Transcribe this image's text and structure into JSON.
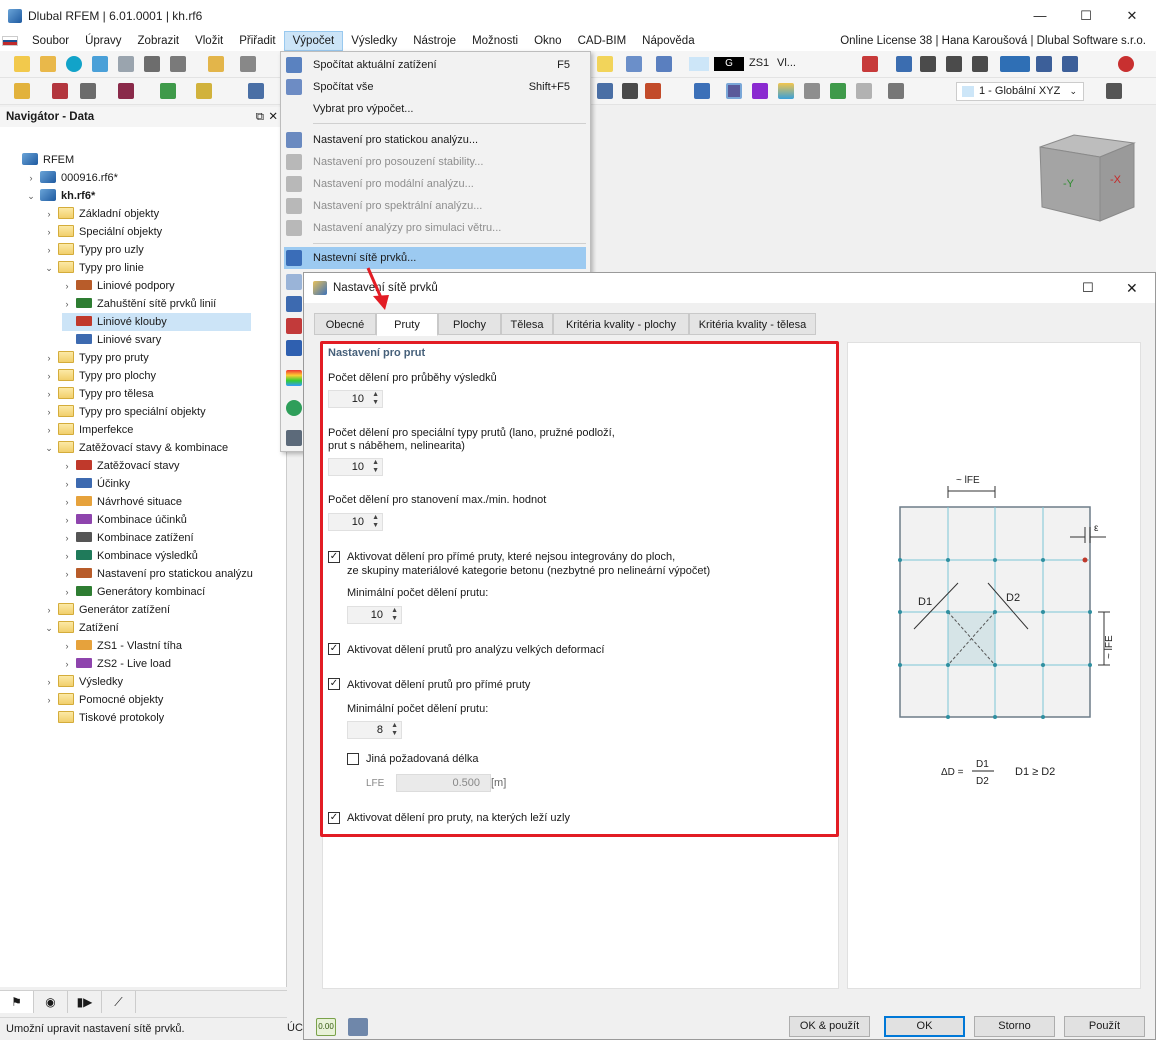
{
  "window": {
    "title": "Dlubal RFEM | 6.01.0001 | kh.rf6",
    "controls": [
      "—",
      "☐",
      "✕"
    ]
  },
  "menubar": {
    "items": [
      "Soubor",
      "Úpravy",
      "Zobrazit",
      "Vložit",
      "Přiřadit",
      "Výpočet",
      "Výsledky",
      "Nástroje",
      "Možnosti",
      "Okno",
      "CAD-BIM",
      "Nápověda"
    ],
    "license": "Online License 38 | Hana Karoušová | Dlubal Software s.r.o."
  },
  "toolbar": {
    "load_case_badge": "G",
    "load_case": "ZS1",
    "load_case_name": "Vl...",
    "view_dropdown": "1 - Globální XYZ"
  },
  "navigator": {
    "title": "Navigátor - Data",
    "pin_icon": "⧉",
    "close_icon": "✕",
    "rows": [
      {
        "label": "RFEM",
        "level": 0,
        "tw": ""
      },
      {
        "label": "000916.rf6*",
        "level": 1,
        "tw": "›"
      },
      {
        "label": "kh.rf6*",
        "level": 1,
        "tw": "⌄"
      },
      {
        "label": "Základní objekty",
        "level": 2,
        "tw": "›"
      },
      {
        "label": "Speciální objekty",
        "level": 2,
        "tw": "›"
      },
      {
        "label": "Typy pro uzly",
        "level": 2,
        "tw": "›"
      },
      {
        "label": "Typy pro linie",
        "level": 2,
        "tw": "⌄"
      },
      {
        "label": "Liniové podpory",
        "level": 3,
        "tw": "›"
      },
      {
        "label": "Zahuštění sítě prvků linií",
        "level": 3,
        "tw": "›"
      },
      {
        "label": "Liniové klouby",
        "level": 3,
        "tw": ""
      },
      {
        "label": "Liniové svary",
        "level": 3,
        "tw": ""
      },
      {
        "label": "Typy pro pruty",
        "level": 2,
        "tw": "›"
      },
      {
        "label": "Typy pro plochy",
        "level": 2,
        "tw": "›"
      },
      {
        "label": "Typy pro tělesa",
        "level": 2,
        "tw": "›"
      },
      {
        "label": "Typy pro speciální objekty",
        "level": 2,
        "tw": "›"
      },
      {
        "label": "Imperfekce",
        "level": 2,
        "tw": "›"
      },
      {
        "label": "Zatěžovací stavy & kombinace",
        "level": 2,
        "tw": "⌄"
      },
      {
        "label": "Zatěžovací stavy",
        "level": 3,
        "tw": "›"
      },
      {
        "label": "Účinky",
        "level": 3,
        "tw": "›"
      },
      {
        "label": "Návrhové situace",
        "level": 3,
        "tw": "›"
      },
      {
        "label": "Kombinace účinků",
        "level": 3,
        "tw": "›"
      },
      {
        "label": "Kombinace zatížení",
        "level": 3,
        "tw": "›"
      },
      {
        "label": "Kombinace výsledků",
        "level": 3,
        "tw": "›"
      },
      {
        "label": "Nastavení pro statickou analýzu",
        "level": 3,
        "tw": "›"
      },
      {
        "label": "Generátory kombinací",
        "level": 3,
        "tw": "›"
      },
      {
        "label": "Generátor zatížení",
        "level": 2,
        "tw": "›"
      },
      {
        "label": "Zatížení",
        "level": 2,
        "tw": "⌄"
      },
      {
        "label": "ZS1 - Vlastní tíha",
        "level": 3,
        "tw": "›"
      },
      {
        "label": "ZS2 - Live load",
        "level": 3,
        "tw": "›"
      },
      {
        "label": "Výsledky",
        "level": 2,
        "tw": "›"
      },
      {
        "label": "Pomocné objekty",
        "level": 2,
        "tw": "›"
      },
      {
        "label": "Tiskové protokoly",
        "level": 2,
        "tw": ""
      }
    ]
  },
  "navigator_tabs": [
    "⚑",
    "◉",
    "▮▶",
    "⟋"
  ],
  "statusbar": {
    "text": "Umožní upravit nastavení sítě prvků.",
    "right_fragment": "ÚCH"
  },
  "dropdown": {
    "items": [
      {
        "label": "Spočítat aktuální zatížení",
        "shortcut": "F5",
        "disabled": false
      },
      {
        "label": "Spočítat vše",
        "shortcut": "Shift+F5",
        "disabled": false
      },
      {
        "label": "Vybrat pro výpočet...",
        "shortcut": "",
        "disabled": false
      },
      {
        "label": "Nastavení pro statickou analýzu...",
        "shortcut": "",
        "disabled": false
      },
      {
        "label": "Nastavení pro posouzení stability...",
        "shortcut": "",
        "disabled": true
      },
      {
        "label": "Nastavení pro modální analýzu...",
        "shortcut": "",
        "disabled": true
      },
      {
        "label": "Nastavení pro spektrální analýzu...",
        "shortcut": "",
        "disabled": true
      },
      {
        "label": "Nastavení analýzy pro simulaci větru...",
        "shortcut": "",
        "disabled": true
      },
      {
        "label": "Nastevní sítě prvků...",
        "shortcut": "",
        "disabled": false
      }
    ]
  },
  "dialog": {
    "title": "Nastavení sítě prvků",
    "max_icon": "☐",
    "close_icon": "✕",
    "tabs": [
      "Obecné",
      "Pruty",
      "Plochy",
      "Tělesa",
      "Kritéria kvality - plochy",
      "Kritéria kvality - tělesa"
    ],
    "active_tab": "Pruty",
    "section_title": "Nastavení pro prut",
    "field1_label": "Počet dělení pro průběhy výsledků",
    "field1_value": "10",
    "field2_label_line1": "Počet dělení pro speciální typy prutů (lano, pružné podloží,",
    "field2_label_line2": "prut s náběhem, nelinearita)",
    "field2_value": "10",
    "field3_label": "Počet dělení pro stanovení max./min. hodnot",
    "field3_value": "10",
    "check1_line1": "Aktivovat dělení pro přímé pruty, které nejsou integrovány do ploch,",
    "check1_line2": "ze skupiny materiálové kategorie betonu (nezbytné pro nelineární výpočet)",
    "check1_checked": true,
    "min_div_label_a": "Minimální počet dělení prutu:",
    "min_div_value_a": "10",
    "check2": "Aktivovat dělení prutů pro analýzu velkých deformací",
    "check2_checked": true,
    "check3": "Aktivovat dělení prutů pro přímé pruty",
    "check3_checked": true,
    "min_div_label_b": "Minimální počet dělení prutu:",
    "min_div_value_b": "8",
    "check4": "Jiná požadovaná délka",
    "check4_checked": false,
    "lfe_label": "LFE",
    "lfe_value": "0.500",
    "lfe_unit": "[m]",
    "check5": "Aktivovat dělení pro pruty, na kterých leží uzly",
    "check5_checked": true,
    "check_mark": "✓",
    "spin_arrows": "▲\n▼",
    "buttons": {
      "ok_apply": "OK & použít",
      "ok": "OK",
      "cancel": "Storno",
      "apply": "Použít"
    },
    "bottom_icon_value": "0.00"
  },
  "diagram": {
    "label_lfe_top": "~ lFE",
    "label_lfe_side": "~ lFE",
    "label_eps": "ε",
    "label_d1": "D1",
    "label_d2": "D2",
    "formula_lhs": "ΔD =",
    "formula_num": "D1",
    "formula_den": "D2",
    "formula_cond": "D1 ≥ D2"
  },
  "colors": {
    "accent_blue": "#0078d7",
    "highlight": "#9ccaf1",
    "red_frame": "#e21c24",
    "mesh_line": "#7cc6d6"
  }
}
